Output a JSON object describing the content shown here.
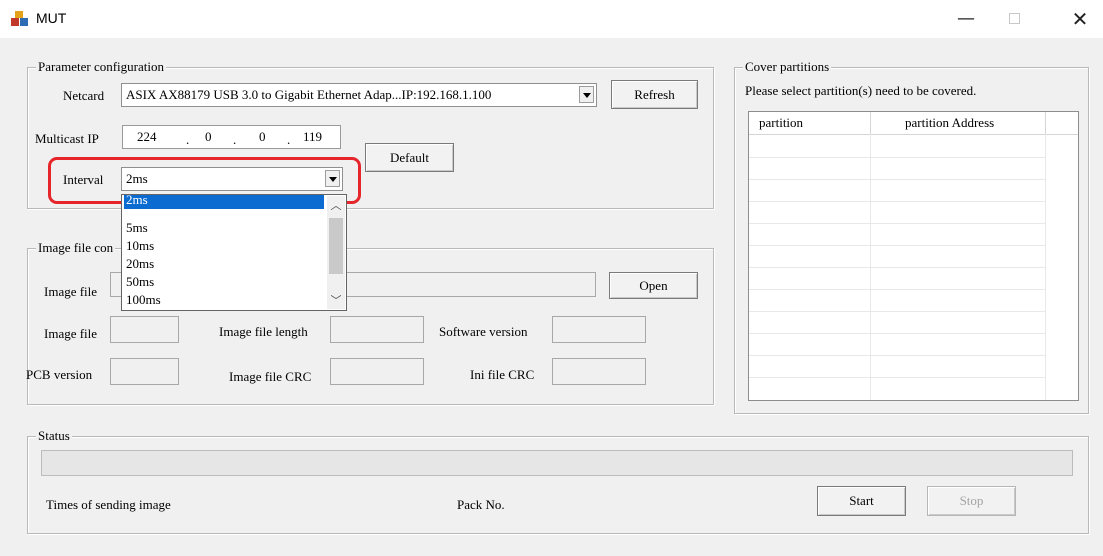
{
  "window": {
    "title": "MUT",
    "minimize": "—",
    "close": "✕",
    "icon": "app-blocks-icon"
  },
  "params": {
    "group_title": "Parameter configuration",
    "netcard_label": "Netcard",
    "netcard_value": "ASIX AX88179 USB 3.0 to Gigabit Ethernet Adap...IP:192.168.1.100",
    "refresh_label": "Refresh",
    "multicast_label": "Multicast IP",
    "ip": [
      "224",
      "0",
      "0",
      "119"
    ],
    "default_label": "Default",
    "interval_label": "Interval",
    "interval_value": "2ms",
    "interval_options": [
      "2ms",
      "5ms",
      "10ms",
      "20ms",
      "50ms",
      "100ms"
    ],
    "interval_selected": "2ms"
  },
  "image": {
    "group_title": "Image file con",
    "image_file_label": "Image file",
    "open_label": "Open",
    "image_file2_label": "Image file",
    "length_label": "Image file length",
    "software_label": "Software version",
    "pcb_label": "PCB version",
    "crc_label": "Image file CRC",
    "ini_label": "Ini file CRC"
  },
  "cover": {
    "group_title": "Cover partitions",
    "hint": "Please select partition(s) need to be covered.",
    "columns": [
      "partition",
      "partition Address"
    ]
  },
  "status": {
    "group_title": "Status",
    "times_label": "Times of sending image",
    "pack_label": "Pack No.",
    "start_label": "Start",
    "stop_label": "Stop"
  },
  "colors": {
    "highlight": "#e5252a",
    "selection": "#0b6bd1"
  }
}
